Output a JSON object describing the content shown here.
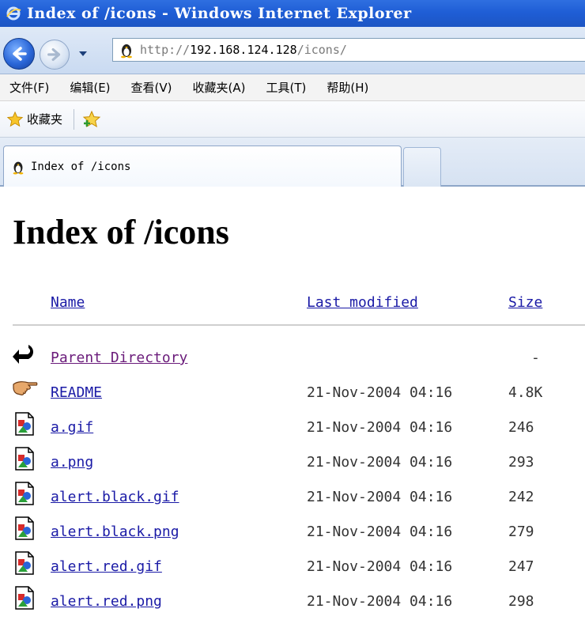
{
  "window": {
    "title": "Index of /icons - Windows Internet Explorer"
  },
  "addressbar": {
    "url_scheme": "http://",
    "url_host": "192.168.124.128",
    "url_path": "/icons/"
  },
  "menu": {
    "items": [
      "文件(F)",
      "编辑(E)",
      "查看(V)",
      "收藏夹(A)",
      "工具(T)",
      "帮助(H)"
    ]
  },
  "favorites": {
    "label": "收藏夹"
  },
  "tab": {
    "label": "Index of /icons"
  },
  "page": {
    "heading": "Index of /icons",
    "columns": {
      "name": "Name",
      "last_modified": "Last modified",
      "size": "Size"
    },
    "rows": [
      {
        "icon": "back-arrow-icon",
        "name": "Parent Directory",
        "date": "",
        "size": "-",
        "visited": true
      },
      {
        "icon": "pointing-hand-icon",
        "name": "README",
        "date": "21-Nov-2004 04:16",
        "size": "4.8K",
        "visited": false
      },
      {
        "icon": "image-file-icon",
        "name": "a.gif",
        "date": "21-Nov-2004 04:16",
        "size": "246",
        "visited": false
      },
      {
        "icon": "image-file-icon",
        "name": "a.png",
        "date": "21-Nov-2004 04:16",
        "size": "293",
        "visited": false
      },
      {
        "icon": "image-file-icon",
        "name": "alert.black.gif",
        "date": "21-Nov-2004 04:16",
        "size": "242",
        "visited": false
      },
      {
        "icon": "image-file-icon",
        "name": "alert.black.png",
        "date": "21-Nov-2004 04:16",
        "size": "279",
        "visited": false
      },
      {
        "icon": "image-file-icon",
        "name": "alert.red.gif",
        "date": "21-Nov-2004 04:16",
        "size": "247",
        "visited": false
      },
      {
        "icon": "image-file-icon",
        "name": "alert.red.png",
        "date": "21-Nov-2004 04:16",
        "size": "298",
        "visited": false
      }
    ]
  },
  "colors": {
    "link": "#1a1aa6",
    "visited_link": "#6a1b7a",
    "titlebar": "#1f5ed6"
  }
}
